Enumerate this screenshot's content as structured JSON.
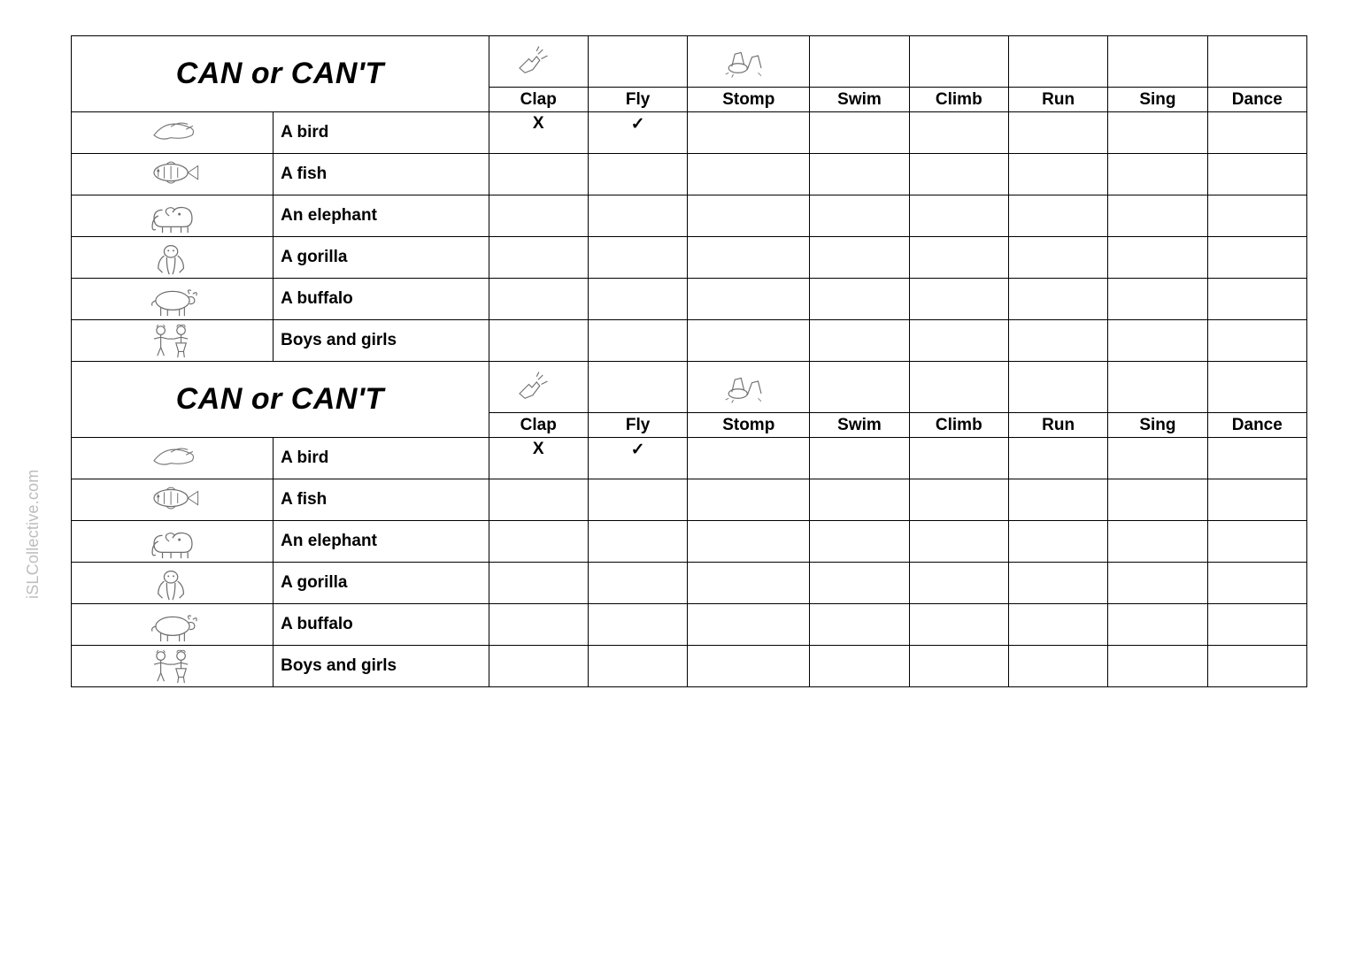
{
  "worksheet": {
    "title": "CAN or CAN'T",
    "actions": [
      "Clap",
      "Fly",
      "Stomp",
      "Swim",
      "Climb",
      "Run",
      "Sing",
      "Dance"
    ],
    "action_icons": [
      "clap-icon",
      "",
      "stomp-icon",
      "",
      "",
      "",
      "",
      ""
    ],
    "rows": [
      {
        "icon": "bird-icon",
        "name": "A bird",
        "answers": [
          "X",
          "✓",
          "",
          "",
          "",
          "",
          "",
          ""
        ]
      },
      {
        "icon": "fish-icon",
        "name": "A fish",
        "answers": [
          "",
          "",
          "",
          "",
          "",
          "",
          "",
          ""
        ]
      },
      {
        "icon": "elephant-icon",
        "name": "An elephant",
        "answers": [
          "",
          "",
          "",
          "",
          "",
          "",
          "",
          ""
        ]
      },
      {
        "icon": "gorilla-icon",
        "name": "A gorilla",
        "answers": [
          "",
          "",
          "",
          "",
          "",
          "",
          "",
          ""
        ]
      },
      {
        "icon": "buffalo-icon",
        "name": "A buffalo",
        "answers": [
          "",
          "",
          "",
          "",
          "",
          "",
          "",
          ""
        ]
      },
      {
        "icon": "children-icon",
        "name": "Boys and girls",
        "answers": [
          "",
          "",
          "",
          "",
          "",
          "",
          "",
          ""
        ]
      }
    ]
  },
  "watermark": "iSLCollective.com"
}
